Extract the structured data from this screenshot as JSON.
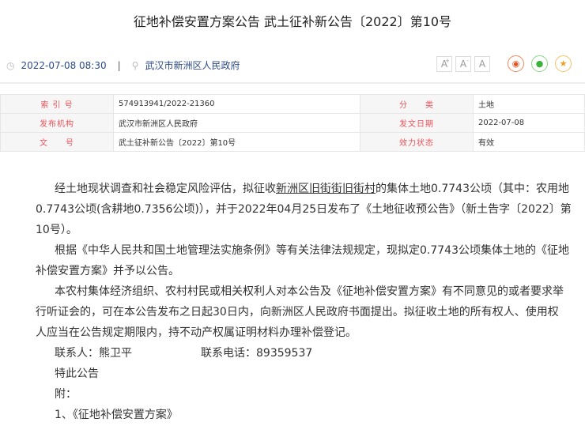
{
  "title": "征地补偿安置方案公告 武土征补新公告〔2022〕第10号",
  "meta": {
    "datetime": "2022-07-08 08:30",
    "separator": "|",
    "publisher": "武汉市新洲区人民政府"
  },
  "font_buttons": [
    "A",
    "A",
    "A"
  ],
  "info_table": [
    {
      "label1": "索 引 号",
      "value1": "574913941/2022-21360",
      "label2": "分　　类",
      "value2": "土地"
    },
    {
      "label1": "发布机构",
      "value1": "武汉市新洲区人民政府",
      "label2": "发文日期",
      "value2": "2022-07-08"
    },
    {
      "label1": "文　　号",
      "value1": "武土征补新公告〔2022〕第10号",
      "label2": "效力状态",
      "value2": "有效"
    }
  ],
  "body": {
    "p1a": "经土地现状调查和社会稳定风险评估，拟征收",
    "p1link": "新洲区旧街街旧街村",
    "p1b": "的集体土地0.7743公顷（其中：农用地",
    "p1l2": "0.7743公顷(含耕地0.7356公顷)），并于2022年04月25日发布了《土地征收预公告》（新土告字〔2022〕第",
    "p1l3": "10号）。",
    "p2l1": "根据《中华人民共和国土地管理法实施条例》等有关法律法规规定，现拟定0.7743公顷集体土地的《征地",
    "p2l2": "补偿安置方案》并予以公告。",
    "p3l1": "本农村集体经济组织、农村村民或相关权利人对本公告及《征地补偿安置方案》有不同意见的或者要求举",
    "p3l2": "行听证会的，可在本公告发布之日起30日内，向新洲区人民政府书面提出。拟征收土地的所有权人、使用权",
    "p3l3": "人应当在公告规定期限内，持不动产权属证明材料办理补偿登记。",
    "contact": "联系人：熊卫平",
    "phone": "联系电话：89359537",
    "closing": "特此公告",
    "attach_label": "附：",
    "attach1": "1、《征地补偿安置方案》"
  }
}
